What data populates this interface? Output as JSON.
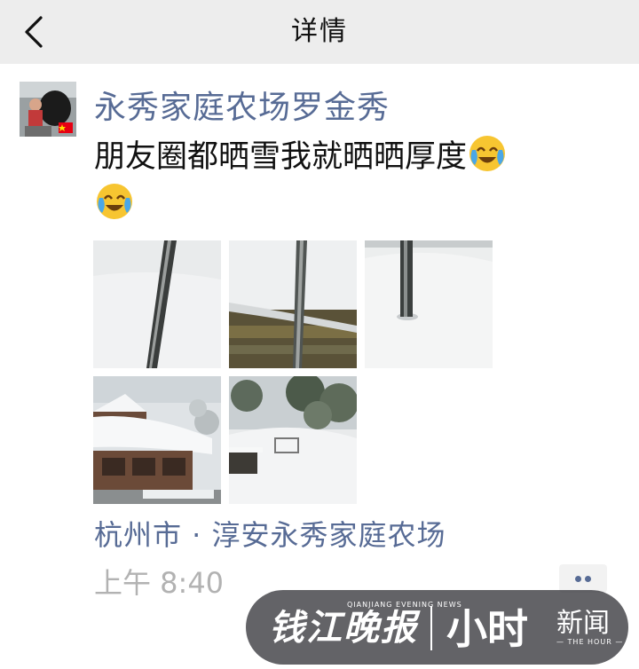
{
  "header": {
    "title": "详情",
    "back_icon": "chevron-left-icon"
  },
  "post": {
    "author": "永秀家庭农场罗金秀",
    "text": "朋友圈都晒雪我就晒晒厚度",
    "emoji": "loudly-crying-face",
    "photos": [
      "snow-depth-pole-1",
      "snow-on-roof-eaves",
      "snow-field-with-pole",
      "snow-covered-house",
      "snowy-yard-with-trees"
    ],
    "location": "杭州市 · 淳安永秀家庭农场",
    "time": "上午 8:40",
    "more_icon": "more-dots-icon"
  },
  "watermark": {
    "logo": "钱江晚报",
    "logo_en": "QIANJIANG EVENING NEWS",
    "brand": "小时",
    "news": "新闻",
    "brand_en": "— THE HOUR —"
  }
}
